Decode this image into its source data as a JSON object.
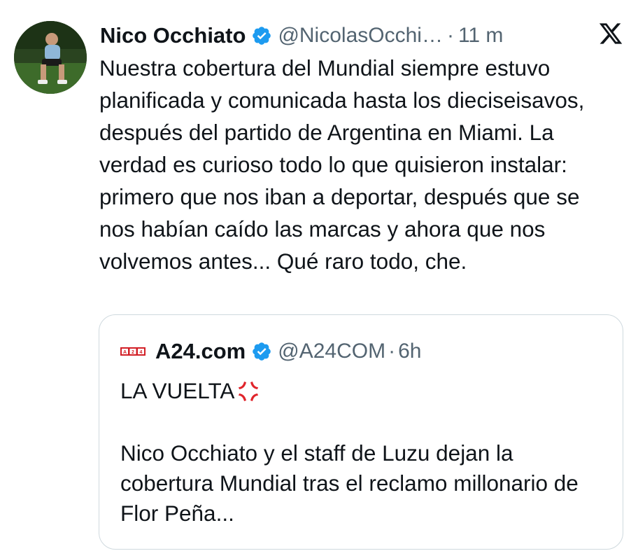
{
  "tweet": {
    "author_name": "Nico Occhiato",
    "handle": "@NicolasOcchi…",
    "separator": "·",
    "time": "11 m",
    "text": "Nuestra cobertura del Mundial siempre estuvo planificada y comunicada hasta los dieciseisavos, después del partido de Argentina en Miami. La verdad es curioso todo lo que quisieron instalar: primero que nos iban a deportar, después que se nos habían caído las marcas y ahora que nos volvemos antes... Qué raro todo, che."
  },
  "quoted_tweet": {
    "logo_text": "A24",
    "author_name": "A24.com",
    "handle": "@A24COM",
    "separator": "·",
    "time": "6h",
    "title": "LA VUELTA",
    "body": "Nico Occhiato y el staff de Luzu dejan la cobertura Mundial tras el reclamo millonario de Flor Peña..."
  },
  "icons": {
    "verified": "verified-badge-icon",
    "platform": "x-logo-icon",
    "emoji": "anger-symbol-icon"
  },
  "colors": {
    "verified": "#1d9bf0",
    "text": "#0f1419",
    "secondary": "#536471",
    "border": "#cfd9de",
    "logo_red": "#d21f26",
    "anger": "#e0242b"
  }
}
